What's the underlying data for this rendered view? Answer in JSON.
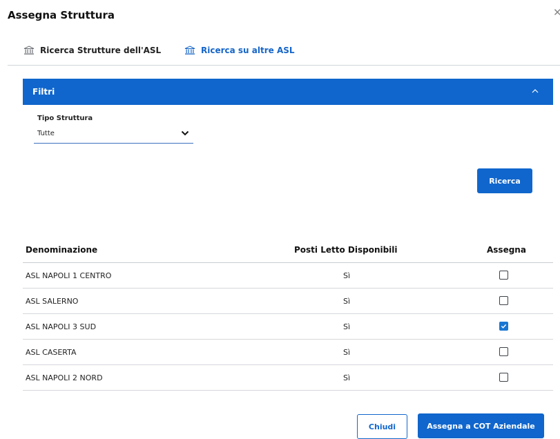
{
  "dialog": {
    "title": "Assegna Struttura",
    "close_icon": "close-icon"
  },
  "tabs": [
    {
      "label": "Ricerca Strutture dell'ASL",
      "icon": "institution-icon",
      "active": false
    },
    {
      "label": "Ricerca su altre ASL",
      "icon": "institution-icon",
      "active": true
    }
  ],
  "filters": {
    "title": "Filtri",
    "collapse_icon": "chevron-up-icon",
    "field_label": "Tipo Struttura",
    "selected_value": "Tutte",
    "search_button": "Ricerca"
  },
  "table": {
    "headers": [
      "Denominazione",
      "Posti Letto Disponibili",
      "Assegna"
    ],
    "rows": [
      {
        "name": "ASL NAPOLI 1 CENTRO",
        "beds": "Sì",
        "assigned": false
      },
      {
        "name": "ASL SALERNO",
        "beds": "Sì",
        "assigned": false
      },
      {
        "name": "ASL NAPOLI 3 SUD",
        "beds": "Sì",
        "assigned": true
      },
      {
        "name": "ASL CASERTA",
        "beds": "Sì",
        "assigned": false
      },
      {
        "name": "ASL NAPOLI 2 NORD",
        "beds": "Sì",
        "assigned": false
      }
    ]
  },
  "footer": {
    "close_button": "Chiudi",
    "assign_button": "Assegna a COT Aziendale"
  },
  "colors": {
    "primary": "#1066cc",
    "link": "#1565c8",
    "checkbox_checked": "#1976d2"
  }
}
